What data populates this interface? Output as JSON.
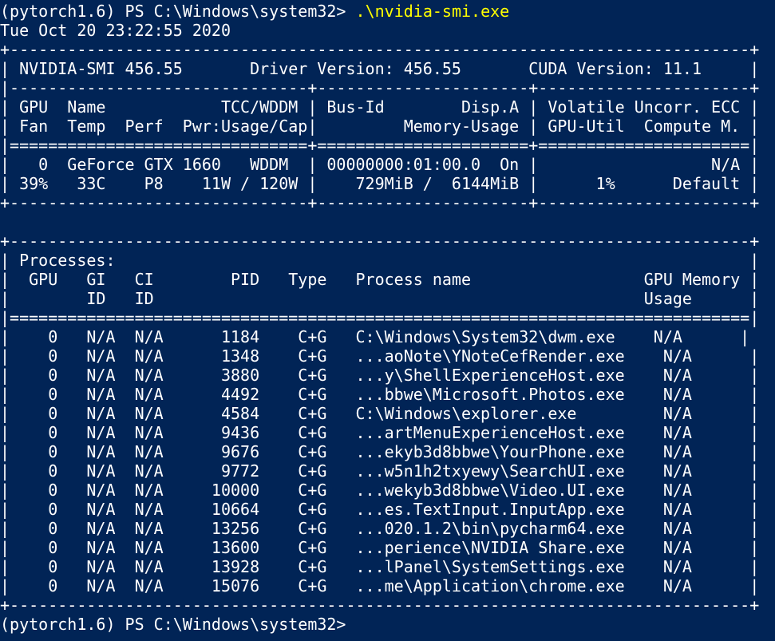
{
  "terminal": {
    "prompt": "(pytorch1.6) PS C:\\Windows\\system32> ",
    "command": ".\\nvidia-smi.exe",
    "timestamp": "Tue Oct 20 23:22:55 2020",
    "final_prompt": "(pytorch1.6) PS C:\\Windows\\system32>"
  },
  "gpu_table": {
    "border_top": "+-----------------------------------------------------------------------------+",
    "version_line": "| NVIDIA-SMI 456.55       Driver Version: 456.55       CUDA Version: 11.1     |",
    "border_mid": "|-------------------------------+----------------------+----------------------+",
    "header_line1": "| GPU  Name            TCC/WDDM | Bus-Id        Disp.A | Volatile Uncorr. ECC |",
    "header_line2": "| Fan  Temp  Perf  Pwr:Usage/Cap|         Memory-Usage | GPU-Util  Compute M. |",
    "border_eq": "|===============================+======================+======================|",
    "gpu_line1": "|   0  GeForce GTX 1660   WDDM  | 00000000:01:00.0  On |                  N/A |",
    "gpu_line2": "| 39%   33C    P8    11W / 120W |    729MiB /  6144MiB |      1%      Default |",
    "border_bottom": "+-------------------------------+----------------------+----------------------+"
  },
  "process_table": {
    "border_top": "+-----------------------------------------------------------------------------+",
    "title_line": "| Processes:                                                                  |",
    "header_line1": "|  GPU   GI   CI        PID   Type   Process name                  GPU Memory |",
    "header_line2": "|        ID   ID                                                   Usage      |",
    "border_eq": "|=============================================================================|",
    "rows": [
      "|    0   N/A  N/A      1184    C+G   C:\\Windows\\System32\\dwm.exe    N/A      |",
      "|    0   N/A  N/A      1348    C+G   ...aoNote\\YNoteCefRender.exe    N/A      |",
      "|    0   N/A  N/A      3880    C+G   ...y\\ShellExperienceHost.exe    N/A      |",
      "|    0   N/A  N/A      4492    C+G   ...bbwe\\Microsoft.Photos.exe    N/A      |",
      "|    0   N/A  N/A      4584    C+G   C:\\Windows\\explorer.exe         N/A      |",
      "|    0   N/A  N/A      9436    C+G   ...artMenuExperienceHost.exe    N/A      |",
      "|    0   N/A  N/A      9676    C+G   ...ekyb3d8bbwe\\YourPhone.exe    N/A      |",
      "|    0   N/A  N/A      9772    C+G   ...w5n1h2txyewy\\SearchUI.exe    N/A      |",
      "|    0   N/A  N/A     10000    C+G   ...wekyb3d8bbwe\\Video.UI.exe    N/A      |",
      "|    0   N/A  N/A     10664    C+G   ...es.TextInput.InputApp.exe    N/A      |",
      "|    0   N/A  N/A     13256    C+G   ...020.1.2\\bin\\pycharm64.exe    N/A      |",
      "|    0   N/A  N/A     13600    C+G   ...perience\\NVIDIA Share.exe    N/A      |",
      "|    0   N/A  N/A     13928    C+G   ...lPanel\\SystemSettings.exe    N/A      |",
      "|    0   N/A  N/A     15076    C+G   ...me\\Application\\chrome.exe    N/A      |"
    ],
    "border_bottom": "+-----------------------------------------------------------------------------+"
  },
  "colors": {
    "background": "#012456",
    "text": "#ffffff",
    "command": "#ffff00"
  }
}
